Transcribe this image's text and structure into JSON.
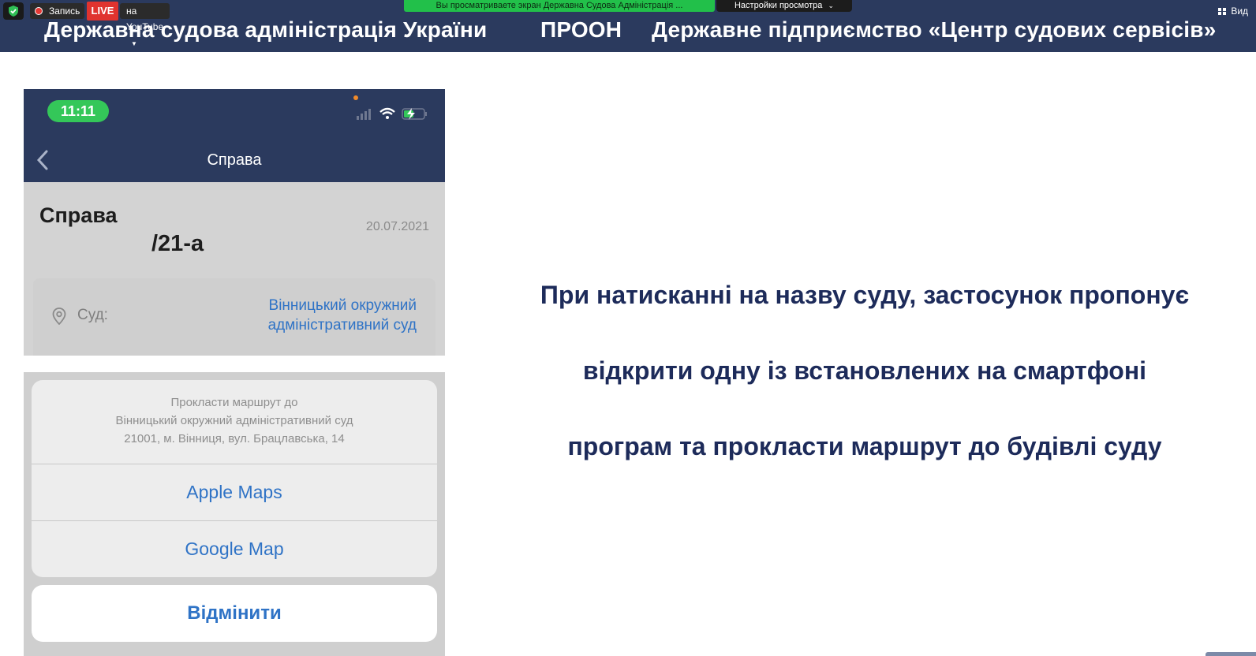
{
  "zoom": {
    "record_label": "Запись",
    "live_label": "LIVE",
    "youtube_label": "на YouTube",
    "screen_share_notice": "Вы просматриваете экран Державна Судова Адміністрація ...",
    "view_settings_label": "Настройки просмотра",
    "view_label": "Вид"
  },
  "banner": {
    "org1": "Державна судова адміністрація України",
    "org2": "ПРООН",
    "org3": "Державне підприємство «Центр судових сервісів»"
  },
  "phone": {
    "time": "11:11",
    "nav_title": "Справа",
    "case_label": "Справа",
    "case_number": "/21-а",
    "case_date": "20.07.2021",
    "court_label": "Суд:",
    "court_value": "Вінницький окружний адміністративний суд"
  },
  "action_sheet": {
    "header_lines": [
      "Прокласти маршрут до",
      "Вінницький окружний адміністративний суд",
      "21001, м. Вінниця, вул. Брацлавська, 14"
    ],
    "options": [
      "Apple Maps",
      "Google Map"
    ],
    "cancel": "Відмінити"
  },
  "caption": [
    "При натисканні на назву суду, застосунок пропонує",
    "відкрити одну із встановлених на смартфоні",
    "програм та прокласти маршрут до будівлі суду"
  ],
  "colors": {
    "banner_bg": "#2b3a5e",
    "caption_text": "#1d2b5a",
    "ios_link": "#2f73c6",
    "live_red": "#e0332f",
    "notice_green": "#22c04a"
  }
}
